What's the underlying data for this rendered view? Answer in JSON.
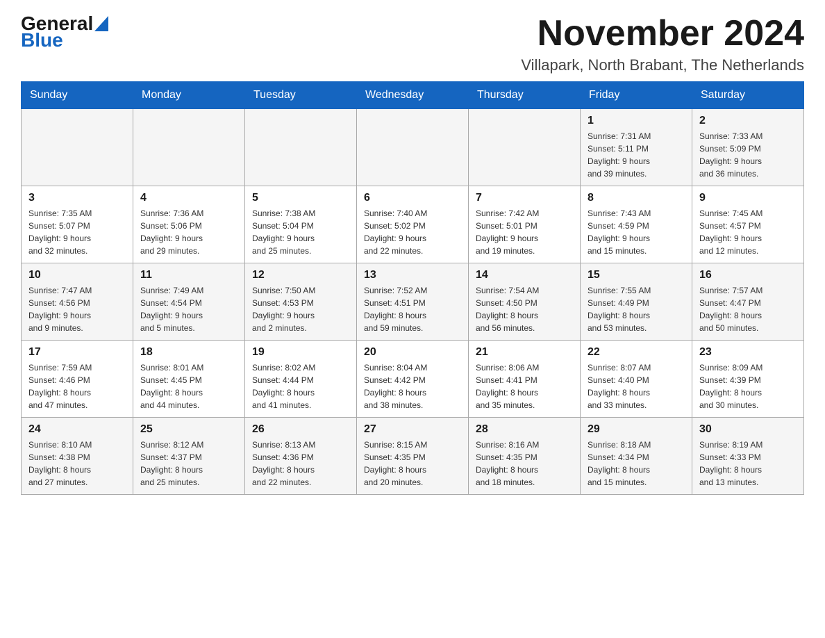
{
  "logo": {
    "general": "General",
    "blue": "Blue"
  },
  "title": "November 2024",
  "location": "Villapark, North Brabant, The Netherlands",
  "weekdays": [
    "Sunday",
    "Monday",
    "Tuesday",
    "Wednesday",
    "Thursday",
    "Friday",
    "Saturday"
  ],
  "rows": [
    {
      "cells": [
        {
          "day": "",
          "info": ""
        },
        {
          "day": "",
          "info": ""
        },
        {
          "day": "",
          "info": ""
        },
        {
          "day": "",
          "info": ""
        },
        {
          "day": "",
          "info": ""
        },
        {
          "day": "1",
          "info": "Sunrise: 7:31 AM\nSunset: 5:11 PM\nDaylight: 9 hours\nand 39 minutes."
        },
        {
          "day": "2",
          "info": "Sunrise: 7:33 AM\nSunset: 5:09 PM\nDaylight: 9 hours\nand 36 minutes."
        }
      ]
    },
    {
      "cells": [
        {
          "day": "3",
          "info": "Sunrise: 7:35 AM\nSunset: 5:07 PM\nDaylight: 9 hours\nand 32 minutes."
        },
        {
          "day": "4",
          "info": "Sunrise: 7:36 AM\nSunset: 5:06 PM\nDaylight: 9 hours\nand 29 minutes."
        },
        {
          "day": "5",
          "info": "Sunrise: 7:38 AM\nSunset: 5:04 PM\nDaylight: 9 hours\nand 25 minutes."
        },
        {
          "day": "6",
          "info": "Sunrise: 7:40 AM\nSunset: 5:02 PM\nDaylight: 9 hours\nand 22 minutes."
        },
        {
          "day": "7",
          "info": "Sunrise: 7:42 AM\nSunset: 5:01 PM\nDaylight: 9 hours\nand 19 minutes."
        },
        {
          "day": "8",
          "info": "Sunrise: 7:43 AM\nSunset: 4:59 PM\nDaylight: 9 hours\nand 15 minutes."
        },
        {
          "day": "9",
          "info": "Sunrise: 7:45 AM\nSunset: 4:57 PM\nDaylight: 9 hours\nand 12 minutes."
        }
      ]
    },
    {
      "cells": [
        {
          "day": "10",
          "info": "Sunrise: 7:47 AM\nSunset: 4:56 PM\nDaylight: 9 hours\nand 9 minutes."
        },
        {
          "day": "11",
          "info": "Sunrise: 7:49 AM\nSunset: 4:54 PM\nDaylight: 9 hours\nand 5 minutes."
        },
        {
          "day": "12",
          "info": "Sunrise: 7:50 AM\nSunset: 4:53 PM\nDaylight: 9 hours\nand 2 minutes."
        },
        {
          "day": "13",
          "info": "Sunrise: 7:52 AM\nSunset: 4:51 PM\nDaylight: 8 hours\nand 59 minutes."
        },
        {
          "day": "14",
          "info": "Sunrise: 7:54 AM\nSunset: 4:50 PM\nDaylight: 8 hours\nand 56 minutes."
        },
        {
          "day": "15",
          "info": "Sunrise: 7:55 AM\nSunset: 4:49 PM\nDaylight: 8 hours\nand 53 minutes."
        },
        {
          "day": "16",
          "info": "Sunrise: 7:57 AM\nSunset: 4:47 PM\nDaylight: 8 hours\nand 50 minutes."
        }
      ]
    },
    {
      "cells": [
        {
          "day": "17",
          "info": "Sunrise: 7:59 AM\nSunset: 4:46 PM\nDaylight: 8 hours\nand 47 minutes."
        },
        {
          "day": "18",
          "info": "Sunrise: 8:01 AM\nSunset: 4:45 PM\nDaylight: 8 hours\nand 44 minutes."
        },
        {
          "day": "19",
          "info": "Sunrise: 8:02 AM\nSunset: 4:44 PM\nDaylight: 8 hours\nand 41 minutes."
        },
        {
          "day": "20",
          "info": "Sunrise: 8:04 AM\nSunset: 4:42 PM\nDaylight: 8 hours\nand 38 minutes."
        },
        {
          "day": "21",
          "info": "Sunrise: 8:06 AM\nSunset: 4:41 PM\nDaylight: 8 hours\nand 35 minutes."
        },
        {
          "day": "22",
          "info": "Sunrise: 8:07 AM\nSunset: 4:40 PM\nDaylight: 8 hours\nand 33 minutes."
        },
        {
          "day": "23",
          "info": "Sunrise: 8:09 AM\nSunset: 4:39 PM\nDaylight: 8 hours\nand 30 minutes."
        }
      ]
    },
    {
      "cells": [
        {
          "day": "24",
          "info": "Sunrise: 8:10 AM\nSunset: 4:38 PM\nDaylight: 8 hours\nand 27 minutes."
        },
        {
          "day": "25",
          "info": "Sunrise: 8:12 AM\nSunset: 4:37 PM\nDaylight: 8 hours\nand 25 minutes."
        },
        {
          "day": "26",
          "info": "Sunrise: 8:13 AM\nSunset: 4:36 PM\nDaylight: 8 hours\nand 22 minutes."
        },
        {
          "day": "27",
          "info": "Sunrise: 8:15 AM\nSunset: 4:35 PM\nDaylight: 8 hours\nand 20 minutes."
        },
        {
          "day": "28",
          "info": "Sunrise: 8:16 AM\nSunset: 4:35 PM\nDaylight: 8 hours\nand 18 minutes."
        },
        {
          "day": "29",
          "info": "Sunrise: 8:18 AM\nSunset: 4:34 PM\nDaylight: 8 hours\nand 15 minutes."
        },
        {
          "day": "30",
          "info": "Sunrise: 8:19 AM\nSunset: 4:33 PM\nDaylight: 8 hours\nand 13 minutes."
        }
      ]
    }
  ]
}
